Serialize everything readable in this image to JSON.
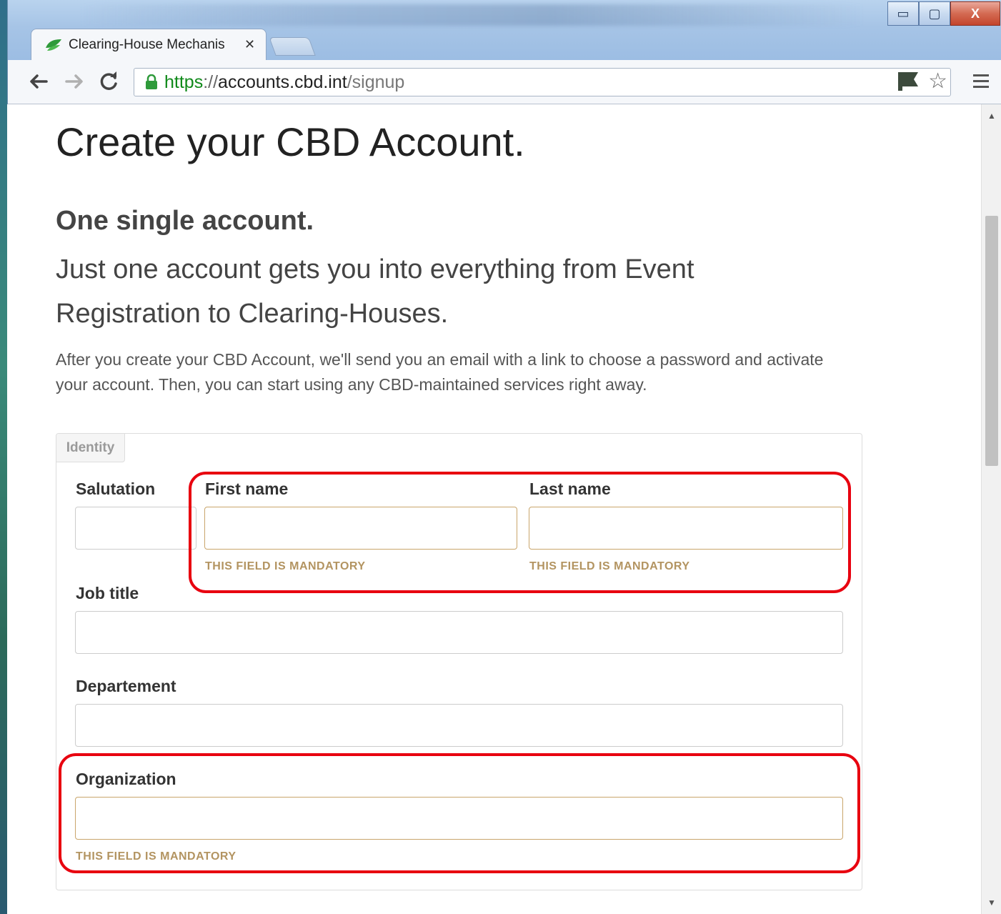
{
  "browser": {
    "tab_title": "Clearing-House Mechanis",
    "tab_close_glyph": "✕",
    "url_scheme": "https",
    "url_separator": "://",
    "url_host": "accounts.cbd.int",
    "url_path": "/signup",
    "window_minimize_glyph": "▭",
    "window_maximize_glyph": "▢",
    "window_close_glyph": "X",
    "icons": {
      "back": "back-arrow-icon",
      "forward": "forward-arrow-icon",
      "reload": "reload-icon",
      "lock": "lock-icon",
      "flag": "flag-icon",
      "star": "star-icon",
      "menu": "hamburger-menu-icon"
    },
    "colors": {
      "secure_green": "#108a1a",
      "titlebar_blue": "#a6c4e6",
      "close_red": "#c4452c"
    }
  },
  "page": {
    "title": "Create your CBD Account.",
    "subtitle": "One single account.",
    "lead": "Just one account gets you into everything from Event Registration to Clearing-Houses.",
    "intro": "After you create your CBD Account, we'll send you an email with a link to choose a password and activate your account. Then, you can start using any CBD-maintained services right away."
  },
  "form": {
    "legend": "Identity",
    "salutation": {
      "label": "Salutation",
      "value": ""
    },
    "first_name": {
      "label": "First name",
      "value": "",
      "help": "THIS FIELD IS MANDATORY"
    },
    "last_name": {
      "label": "Last name",
      "value": "",
      "help": "THIS FIELD IS MANDATORY"
    },
    "job_title": {
      "label": "Job title",
      "value": ""
    },
    "department": {
      "label": "Departement",
      "value": ""
    },
    "organization": {
      "label": "Organization",
      "value": "",
      "help": "THIS FIELD IS MANDATORY"
    },
    "colors": {
      "mandatory_border": "#c9a56b",
      "mandatory_text": "#b39461",
      "annotation_red": "#e8000f"
    }
  }
}
